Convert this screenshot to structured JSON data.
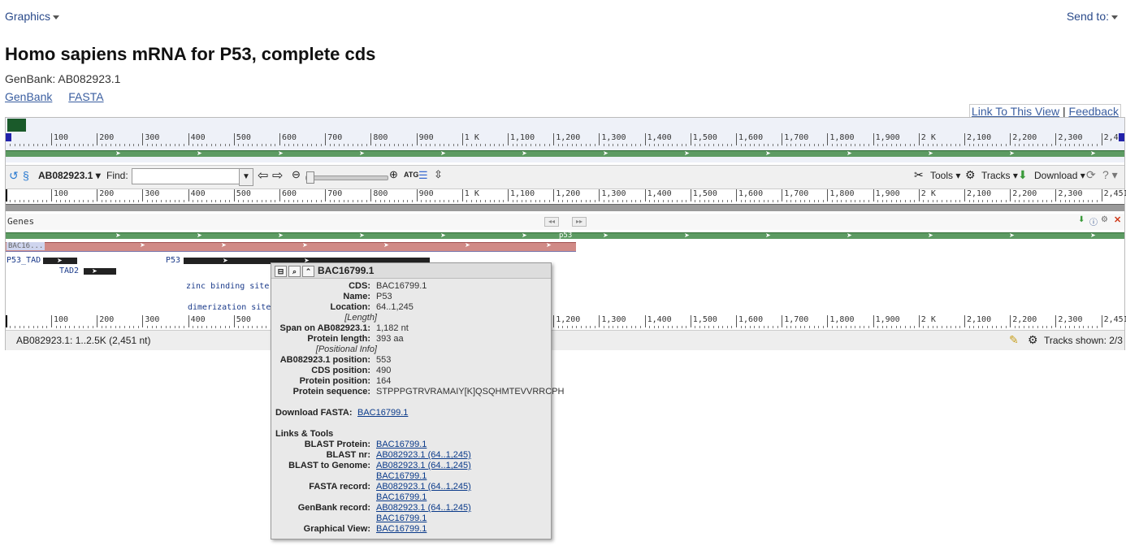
{
  "topnav": {
    "graphics": "Graphics",
    "send_to": "Send to:"
  },
  "page": {
    "title": "Homo sapiens mRNA for P53, complete cds",
    "accession": "GenBank: AB082923.1"
  },
  "links": [
    "GenBank",
    "FASTA"
  ],
  "view_links": {
    "link": "Link To This View",
    "sep": "|",
    "feedback": "Feedback"
  },
  "ruler": {
    "overview_ticks": [
      "100",
      "200",
      "300",
      "400",
      "500",
      "600",
      "700",
      "800",
      "900",
      "1 K",
      "1,100",
      "1,200",
      "1,300",
      "1,400",
      "1,500",
      "1,600",
      "1,700",
      "1,800",
      "1,900",
      "2 K",
      "2,100",
      "2,200",
      "2,300",
      "2,4"
    ],
    "main_ticks": [
      "100",
      "200",
      "300",
      "400",
      "500",
      "600",
      "700",
      "800",
      "900",
      "1 K",
      "1,100",
      "1,200",
      "1,300",
      "1,400",
      "1,500",
      "1,600",
      "1,700",
      "1,800",
      "1,900",
      "2 K",
      "2,100",
      "2,200",
      "2,300",
      "2,451"
    ],
    "start": "1"
  },
  "toolbar": {
    "sequence": "AB082923.1",
    "find_label": "Find:",
    "find_value": "",
    "tools": "Tools",
    "tracks": "Tracks",
    "download": "Download"
  },
  "track": {
    "name": "Genes",
    "gene_label": "p53",
    "mrna_label": "BAC16...",
    "features": [
      "P53_TAD",
      "TAD2",
      "P53",
      "zinc binding site [i...",
      "dimerization site [p..."
    ]
  },
  "status": {
    "range": "AB082923.1: 1..2.5K (2,451 nt)",
    "tracks_shown": "Tracks shown: 2/3"
  },
  "popup": {
    "title": "BAC16799.1",
    "rows": [
      {
        "label": "CDS:",
        "value": "BAC16799.1"
      },
      {
        "label": "Name:",
        "value": "P53"
      },
      {
        "label": "Location:",
        "value": "64..1,245"
      },
      {
        "label": "Span on AB082923.1:",
        "value": "1,182 nt"
      },
      {
        "label": "Protein length:",
        "value": "393 aa"
      },
      {
        "label": "AB082923.1 position:",
        "value": "553"
      },
      {
        "label": "CDS position:",
        "value": "490"
      },
      {
        "label": "Protein position:",
        "value": "164"
      },
      {
        "label": "Protein sequence:",
        "value": "STPPPGTRVRAMAIY[K]QSQHMTEVVRRCPH"
      }
    ],
    "length_header": "[Length]",
    "positional_header": "[Positional Info]",
    "download_label": "Download FASTA:",
    "download_link": "BAC16799.1",
    "links_title": "Links & Tools",
    "tools": [
      {
        "label": "BLAST Protein:",
        "links": [
          "BAC16799.1"
        ]
      },
      {
        "label": "BLAST nr:",
        "links": [
          "AB082923.1 (64..1,245)"
        ]
      },
      {
        "label": "BLAST to Genome:",
        "links": [
          "AB082923.1 (64..1,245)",
          "BAC16799.1"
        ]
      },
      {
        "label": "FASTA record:",
        "links": [
          "AB082923.1 (64..1,245)",
          "BAC16799.1"
        ]
      },
      {
        "label": "GenBank record:",
        "links": [
          "AB082923.1 (64..1,245)",
          "BAC16799.1"
        ]
      },
      {
        "label": "Graphical View:",
        "links": [
          "BAC16799.1"
        ]
      }
    ]
  },
  "colors": {
    "accent_link": "#3a5ea0",
    "gene_bar": "#5d9b63",
    "mrna_bar": "#d08a86",
    "feature_bar": "#222222"
  }
}
